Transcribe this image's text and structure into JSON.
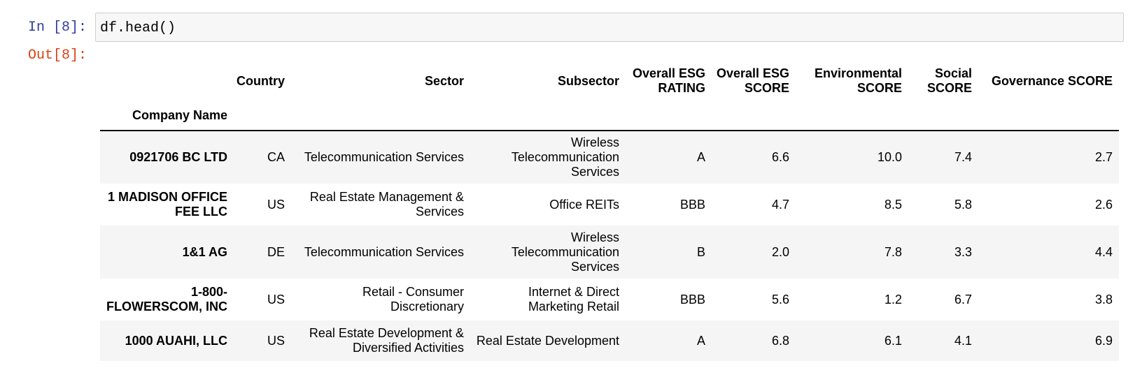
{
  "cell": {
    "in_prompt": "In [8]:",
    "code": "df.head()",
    "out_prompt": "Out[8]:"
  },
  "table": {
    "columns": [
      "Country",
      "Sector",
      "Subsector",
      "Overall ESG RATING",
      "Overall ESG SCORE",
      "Environmental SCORE",
      "Social SCORE",
      "Governance SCORE"
    ],
    "index_name": "Company Name",
    "rows": [
      {
        "company": "0921706 BC LTD",
        "cells": [
          "CA",
          "Telecommunication Services",
          "Wireless Telecommunication Services",
          "A",
          "6.6",
          "10.0",
          "7.4",
          "2.7"
        ]
      },
      {
        "company": "1 MADISON OFFICE FEE LLC",
        "cells": [
          "US",
          "Real Estate Management & Services",
          "Office REITs",
          "BBB",
          "4.7",
          "8.5",
          "5.8",
          "2.6"
        ]
      },
      {
        "company": "1&1 AG",
        "cells": [
          "DE",
          "Telecommunication Services",
          "Wireless Telecommunication Services",
          "B",
          "2.0",
          "7.8",
          "3.3",
          "4.4"
        ]
      },
      {
        "company": "1-800-FLOWERSCOM, INC",
        "cells": [
          "US",
          "Retail - Consumer Discretionary",
          "Internet & Direct Marketing Retail",
          "BBB",
          "5.6",
          "1.2",
          "6.7",
          "3.8"
        ]
      },
      {
        "company": "1000 AUAHI, LLC",
        "cells": [
          "US",
          "Real Estate Development & Diversified Activities",
          "Real Estate Development",
          "A",
          "6.8",
          "6.1",
          "4.1",
          "6.9"
        ]
      }
    ]
  }
}
